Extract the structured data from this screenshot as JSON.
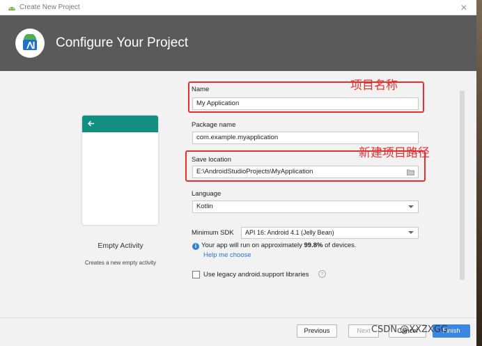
{
  "titlebar": {
    "title": "Create New Project",
    "close_glyph": "✕"
  },
  "header": {
    "title": "Configure Your Project"
  },
  "template": {
    "name": "Empty Activity",
    "description": "Creates a new empty activity"
  },
  "form": {
    "name_label": "Name",
    "name_value": "My Application",
    "package_label": "Package name",
    "package_value": "com.example.myapplication",
    "save_label": "Save location",
    "save_value": "E:\\AndroidStudioProjects\\MyApplication",
    "language_label": "Language",
    "language_value": "Kotlin",
    "min_sdk_label": "Minimum SDK",
    "min_sdk_value": "API 16: Android 4.1 (Jelly Bean)",
    "info_prefix": "Your app will run on approximately ",
    "info_percent": "99.8%",
    "info_suffix": " of devices.",
    "help_link": "Help me choose",
    "legacy_label": "Use legacy android.support libraries"
  },
  "annotations": {
    "name_note": "项目名称",
    "path_note": "新建项目路径"
  },
  "buttons": {
    "previous": "Previous",
    "next": "Next",
    "cancel": "Cancel",
    "finish": "Finish"
  },
  "watermark": "CSDN @XXZXGG",
  "colors": {
    "header_bg": "#5a5a5a",
    "appbar": "#138f7f",
    "annotation": "#e53030",
    "primary": "#3b87e0"
  }
}
